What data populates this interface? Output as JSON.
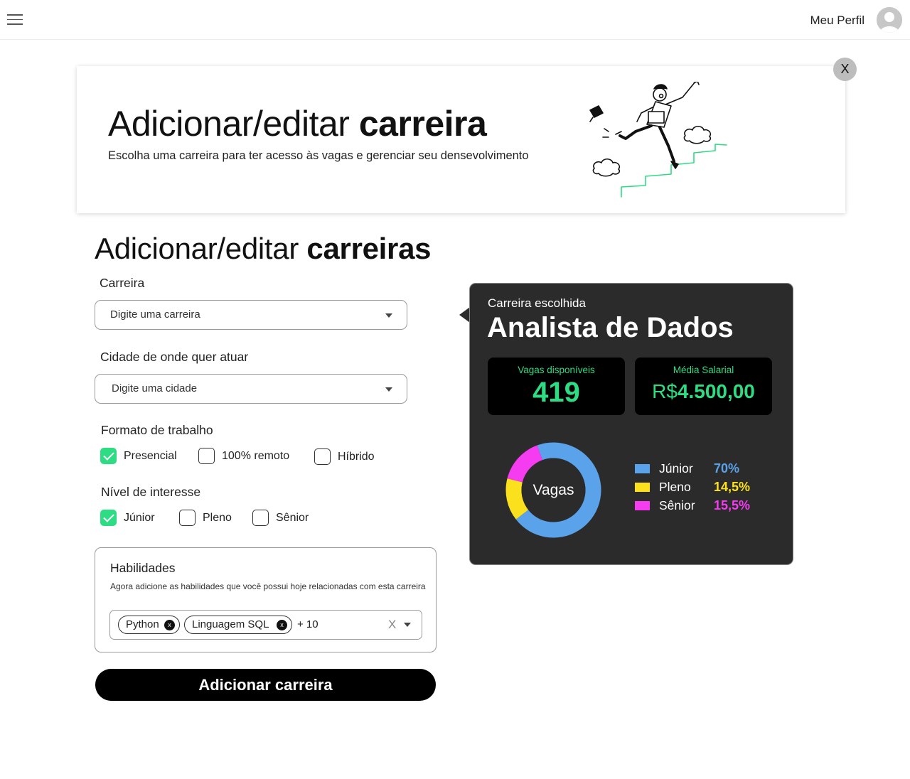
{
  "header": {
    "menu_icon": "hamburger-menu-icon",
    "profile_label": "Meu Perfil",
    "avatar_icon": "user-avatar-icon"
  },
  "hero": {
    "title_light": "Adicionar/editar ",
    "title_bold": "carreira",
    "subtitle": "Escolha uma carreira para ter acesso às vagas e gerenciar seu densevolvimento",
    "close_label": "X"
  },
  "form": {
    "title_light": "Adicionar/editar ",
    "title_bold": "carreiras",
    "career": {
      "label": "Carreira",
      "placeholder": "Digite uma carreira"
    },
    "city": {
      "label": "Cidade de onde quer atuar",
      "placeholder": "Digite uma cidade"
    },
    "work_format": {
      "label": "Formato de trabalho",
      "options": [
        {
          "label": "Presencial",
          "checked": true
        },
        {
          "label": "100% remoto",
          "checked": false
        },
        {
          "label": "Híbrido",
          "checked": false
        }
      ]
    },
    "interest_level": {
      "label": "Nível de interesse",
      "options": [
        {
          "label": "Júnior",
          "checked": true
        },
        {
          "label": "Pleno",
          "checked": false
        },
        {
          "label": "Sênior",
          "checked": false
        }
      ]
    },
    "skills": {
      "title": "Habilidades",
      "description": "Agora adicione as habilidades que você possui hoje relacionadas com esta carreira",
      "chips": [
        {
          "label": "Python",
          "remove": "x"
        },
        {
          "label": "Linguagem SQL",
          "remove": "x"
        }
      ],
      "more": "+ 10",
      "clear": "X"
    },
    "submit_label": "Adicionar carreira"
  },
  "career_panel": {
    "subtitle": "Carreira escolhida",
    "title": "Analista de Dados",
    "openings": {
      "label": "Vagas disponíveis",
      "value": "419"
    },
    "salary": {
      "label": "Média Salarial",
      "currency": "R$",
      "value": "4.500,00"
    },
    "accent_color": "#2ddc83"
  },
  "chart_data": {
    "type": "pie",
    "center_label": "Vagas",
    "categories": [
      "Júnior",
      "Pleno",
      "Sênior"
    ],
    "values": [
      70,
      14.5,
      15.5
    ],
    "labels": [
      "70%",
      "14,5%",
      "15,5%"
    ],
    "colors": [
      "#5aa2ea",
      "#fbe01e",
      "#f53cf0"
    ],
    "legend": "right"
  }
}
